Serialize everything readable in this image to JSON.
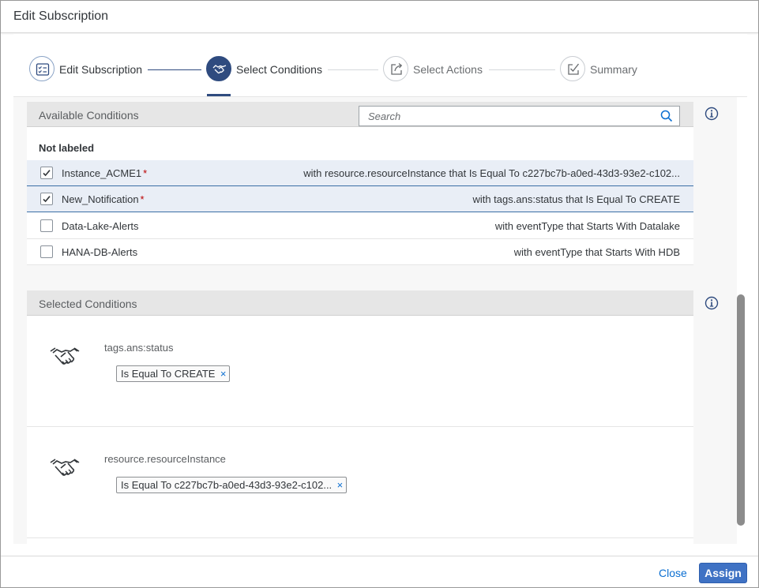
{
  "dialog": {
    "title": "Edit Subscription"
  },
  "wizard": {
    "steps": [
      {
        "label": "Edit Subscription",
        "icon": "form-icon",
        "state": "completed"
      },
      {
        "label": "Select Conditions",
        "icon": "handshake-icon",
        "state": "active"
      },
      {
        "label": "Select Actions",
        "icon": "share-icon",
        "state": "future"
      },
      {
        "label": "Summary",
        "icon": "checklist-icon",
        "state": "future"
      }
    ]
  },
  "available": {
    "title": "Available Conditions",
    "search_placeholder": "Search",
    "group_title": "Not labeled",
    "rows": [
      {
        "name": "Instance_ACME1",
        "required": "*",
        "desc": "with resource.resourceInstance that Is Equal To c227bc7b-a0ed-43d3-93e2-c102...",
        "checked": true
      },
      {
        "name": "New_Notification",
        "required": "*",
        "desc": "with tags.ans:status that Is Equal To CREATE",
        "checked": true
      },
      {
        "name": "Data-Lake-Alerts",
        "required": "",
        "desc": "with eventType that Starts With Datalake",
        "checked": false
      },
      {
        "name": "HANA-DB-Alerts",
        "required": "",
        "desc": "with eventType that Starts With HDB",
        "checked": false
      }
    ]
  },
  "selected": {
    "title": "Selected Conditions",
    "items": [
      {
        "field": "tags.ans:status",
        "token": "Is Equal To CREATE",
        "remove": "×"
      },
      {
        "field": "resource.resourceInstance",
        "token": "Is Equal To c227bc7b-a0ed-43d3-93e2-c102...",
        "remove": "×"
      }
    ]
  },
  "footer": {
    "close_label": "Close",
    "assign_label": "Assign"
  },
  "colors": {
    "accent": "#2f4b7f",
    "link": "#0a6ed1",
    "emphasized": "#3f72c4",
    "required": "#bb0000"
  }
}
